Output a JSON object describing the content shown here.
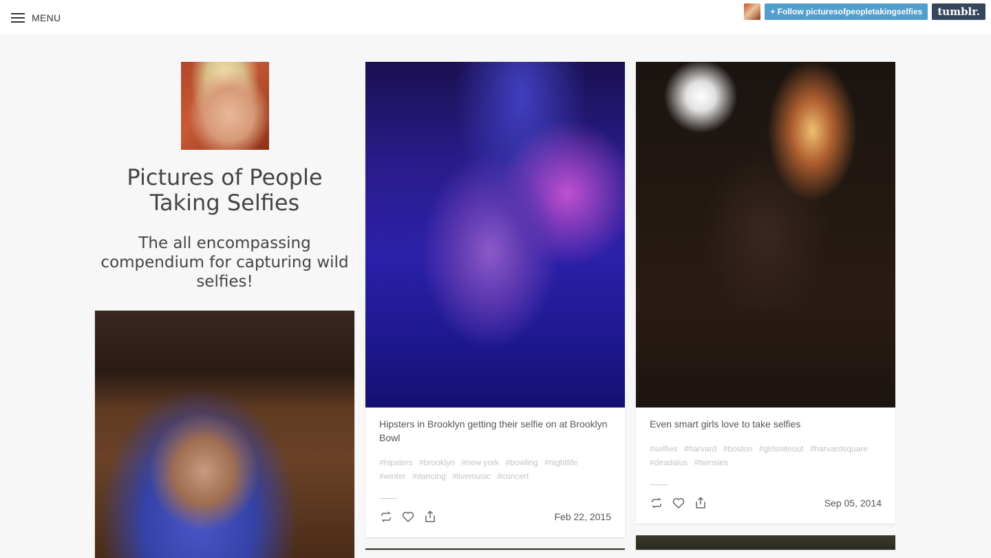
{
  "topbar": {
    "menu_label": "MENU",
    "follow_label": "+ Follow picturesofpeopletakingselfies",
    "tumblr_logo": "tumblr."
  },
  "sidebar": {
    "title": "Pictures of People Taking Selfies",
    "description": "The all encompassing compendium for capturing wild selfies!"
  },
  "posts": [
    {
      "caption": "Hipsters in Brooklyn getting their selfie on at Brooklyn Bowl",
      "tags": [
        "#hipsters",
        "#brooklyn",
        "#new york",
        "#bowling",
        "#nightlife",
        "#winter",
        "#dancing",
        "#livemusic",
        "#concert"
      ],
      "date": "Feb 22, 2015"
    },
    {
      "caption": "Even smart girls love to take selfies",
      "tags": [
        "#selfies",
        "#harvard",
        "#boston",
        "#girlsniteout",
        "#harvardsquare",
        "#deadalus",
        "#twinsies"
      ],
      "date": "Sep 05, 2014"
    }
  ],
  "icons": {
    "reblog": "reblog-icon",
    "like": "heart-icon",
    "share": "share-icon",
    "menu": "hamburger-icon"
  },
  "colors": {
    "follow_button": "#529ecc",
    "tumblr_logo_bg": "#35465c",
    "page_bg": "#f7f7f7",
    "tag_text": "#c4c4c4"
  }
}
